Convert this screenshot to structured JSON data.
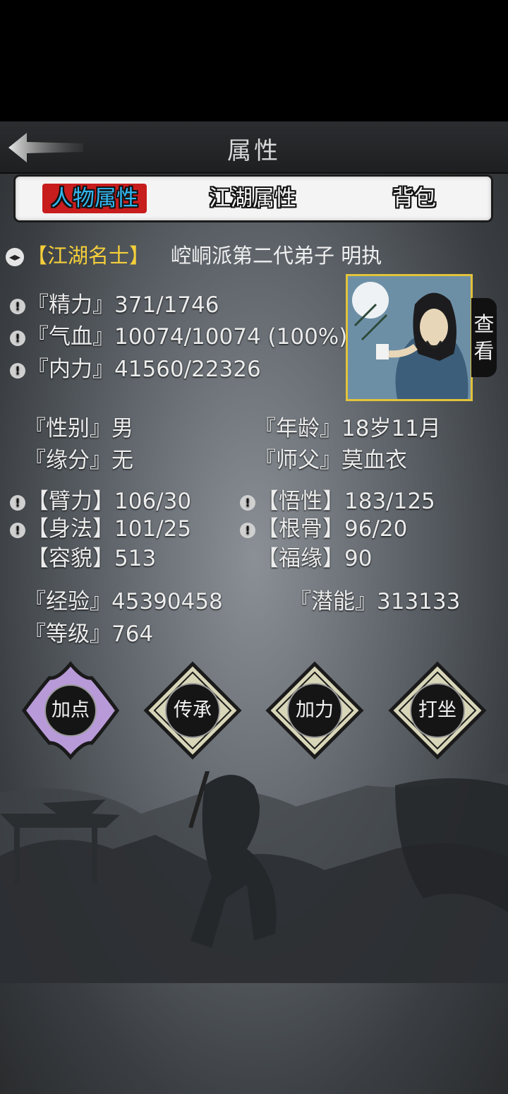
{
  "header": {
    "title": "属性"
  },
  "tabs": [
    {
      "label": "人物属性",
      "active": true
    },
    {
      "label": "江湖属性",
      "active": false
    },
    {
      "label": "背包",
      "active": false
    }
  ],
  "character": {
    "rank": "【江湖名士】",
    "identity": "崆峒派第二代弟子 明执",
    "view_button": "查看"
  },
  "vitals": {
    "jingli": "『精力』371/1746",
    "qixue": "『气血』10074/10074 (100%)",
    "neili": "『内力』41560/22326"
  },
  "info": {
    "gender": "『性别』男",
    "age": "『年龄』18岁11月",
    "fate": "『缘分』无",
    "master": "『师父』莫血衣"
  },
  "attributes": {
    "strength": "【臂力】106/30",
    "comprehension": "【悟性】183/125",
    "agility": "【身法】101/25",
    "constitution": "【根骨】96/20",
    "appearance": "【容貌】513",
    "luck": "【福缘】90"
  },
  "progress": {
    "experience": "『经验』45390458",
    "potential": "『潜能』313133",
    "level": "『等级』764"
  },
  "actions": [
    {
      "label": "加点",
      "selected": true
    },
    {
      "label": "传承",
      "selected": false
    },
    {
      "label": "加力",
      "selected": false
    },
    {
      "label": "打坐",
      "selected": false
    }
  ],
  "colors": {
    "rank_gold": "#f5cf3a",
    "tab_active_bg": "#c81d1d",
    "tab_active_text": "#33b6f0",
    "action_selected": "#b89ad8",
    "action_default": "#d8d6b8"
  }
}
